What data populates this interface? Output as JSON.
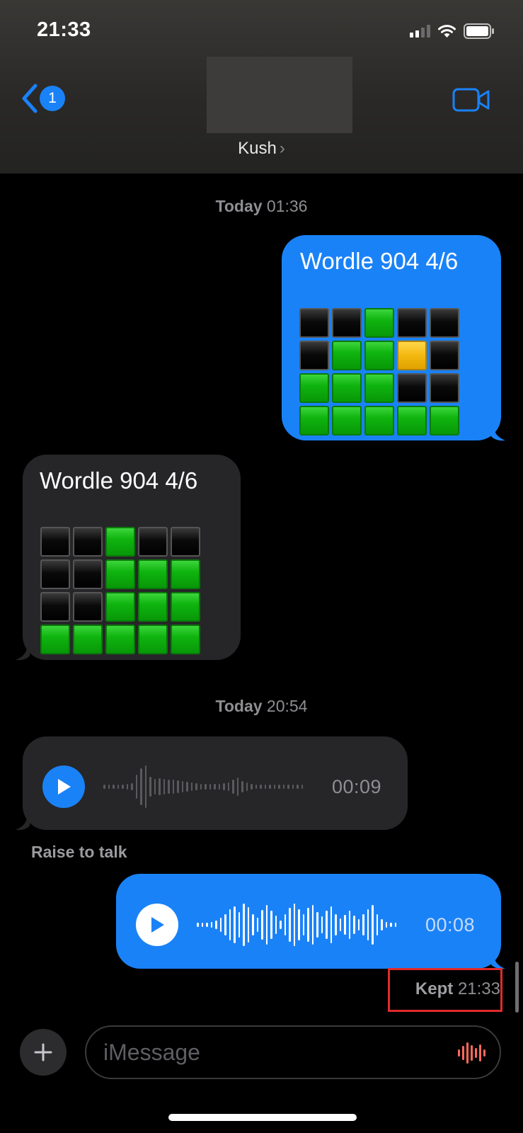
{
  "status_bar": {
    "time": "21:33"
  },
  "header": {
    "back_badge": "1",
    "contact_name": "Kush",
    "contact_chevron": "›"
  },
  "timestamps": [
    {
      "day": "Today",
      "time": "01:36"
    },
    {
      "day": "Today",
      "time": "20:54"
    }
  ],
  "messages": [
    {
      "from": "me",
      "text": "Wordle 904 4/6",
      "grid": [
        [
          "b",
          "b",
          "g",
          "b",
          "b"
        ],
        [
          "b",
          "g",
          "g",
          "y",
          "b"
        ],
        [
          "g",
          "g",
          "g",
          "b",
          "b"
        ],
        [
          "g",
          "g",
          "g",
          "g",
          "g"
        ]
      ]
    },
    {
      "from": "them",
      "text": "Wordle 904 4/6",
      "grid": [
        [
          "b",
          "b",
          "g",
          "b",
          "b"
        ],
        [
          "b",
          "b",
          "g",
          "g",
          "g"
        ],
        [
          "b",
          "b",
          "g",
          "g",
          "g"
        ],
        [
          "g",
          "g",
          "g",
          "g",
          "g"
        ]
      ]
    },
    {
      "from": "them",
      "type": "audio",
      "duration": "00:09"
    },
    {
      "from": "me",
      "type": "audio",
      "duration": "00:08"
    }
  ],
  "raise_to_talk": "Raise to talk",
  "kept": {
    "label": "Kept",
    "time": "21:33"
  },
  "composer": {
    "placeholder": "iMessage"
  },
  "colors": {
    "blue": "#1a82f7",
    "gray_bubble": "#262628",
    "highlight": "#e02b2b",
    "mic": "#ff6b5c"
  },
  "icons": [
    "back-chevron-icon",
    "video-camera-icon",
    "play-icon",
    "plus-icon",
    "audio-waveform-icon",
    "signal-icon",
    "wifi-icon",
    "battery-icon"
  ]
}
